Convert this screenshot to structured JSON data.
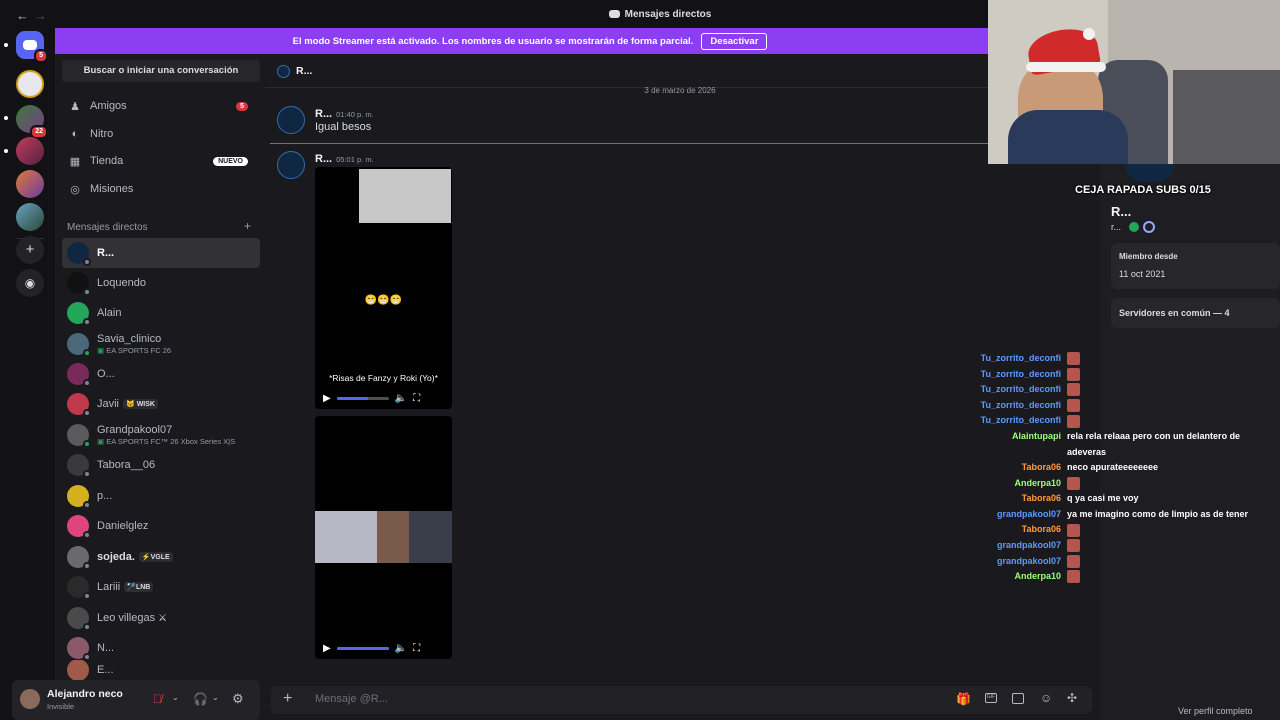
{
  "titlebar": {
    "title": "Mensajes directos",
    "back": "←",
    "forward": "→"
  },
  "banner": {
    "text": "El modo Streamer está activado. Los nombres de usuario se mostrarán de forma parcial.",
    "button": "Desactivar"
  },
  "rail": {
    "home_badge": "5",
    "server_badge": "22"
  },
  "sidebar": {
    "search": "Buscar o iniciar una conversación",
    "nav": [
      {
        "label": "Amigos",
        "badge": "5"
      },
      {
        "label": "Nitro"
      },
      {
        "label": "Tienda",
        "badge": "NUEVO"
      },
      {
        "label": "Misiones"
      }
    ],
    "dm_header": "Mensajes directos",
    "dms": [
      {
        "name": "R...",
        "sub": ""
      },
      {
        "name": "Loquendo",
        "sub": ""
      },
      {
        "name": "Alain",
        "sub": ""
      },
      {
        "name": "Savia_clinico",
        "sub": "EA SPORTS FC 26"
      },
      {
        "name": "O...",
        "sub": ""
      },
      {
        "name": "Javii",
        "tag": "WISK"
      },
      {
        "name": "Grandpakool07",
        "sub": "EA SPORTS FC™ 26 Xbox Series X|S"
      },
      {
        "name": "Tabora__06",
        "sub": ""
      },
      {
        "name": "p...",
        "sub": ""
      },
      {
        "name": "Danielglez",
        "sub": ""
      },
      {
        "name": "sojeda.",
        "tag": "VGLE"
      },
      {
        "name": "Lariii",
        "tag": "LNB"
      },
      {
        "name": "Leo villegas",
        "sub": ""
      },
      {
        "name": "N...",
        "sub": ""
      },
      {
        "name": "E...",
        "sub": ""
      }
    ]
  },
  "user": {
    "name": "Alejandro neco",
    "status": "Invisible"
  },
  "chat": {
    "header": "R...",
    "date": "3 de marzo de 2026",
    "messages": [
      {
        "author": "R...",
        "time": "01:40 p. m.",
        "text": "Igual besos"
      },
      {
        "author": "R...",
        "time": "05:01 p. m."
      }
    ],
    "video1_caption": "*Risas de Fanzy y Roki (Yo)*",
    "video1_emoji": "😁😁😁",
    "video1_progress": 0.6,
    "video2_progress": 1.0,
    "composer_placeholder": "Mensaje @R..."
  },
  "profile": {
    "name": "R...",
    "username": "r...",
    "member_since_label": "Miembro desde",
    "member_since": "11 oct 2021",
    "servers": "Servidores en común — 4",
    "full_profile": "Ver perfil completo"
  },
  "overlay": {
    "cam_text": "CEJA RAPADA SUBS 0/15"
  },
  "twitch_chat": [
    {
      "user": "Tu_zorrito_deconfi",
      "color": "#5b9bff",
      "msg": "",
      "emote": true
    },
    {
      "user": "Tu_zorrito_deconfi",
      "color": "#5b9bff",
      "msg": "",
      "emote": true
    },
    {
      "user": "Tu_zorrito_deconfi",
      "color": "#5b9bff",
      "msg": "",
      "emote": true
    },
    {
      "user": "Tu_zorrito_deconfi",
      "color": "#5b9bff",
      "msg": "",
      "emote": true
    },
    {
      "user": "Tu_zorrito_deconfi",
      "color": "#5b9bff",
      "msg": "",
      "emote": true
    },
    {
      "user": "Alaintupapi",
      "color": "#9cff7a",
      "msg": "rela rela relaaa pero con un delantero de adeveras",
      "emote": false
    },
    {
      "user": "Tabora06",
      "color": "#ff9a3c",
      "msg": "neco apurateeeeeeee",
      "emote": false
    },
    {
      "user": "Anderpa10",
      "color": "#9cff7a",
      "msg": "",
      "emote": true
    },
    {
      "user": "Tabora06",
      "color": "#ff9a3c",
      "msg": "q ya casi me voy",
      "emote": false
    },
    {
      "user": "grandpakool07",
      "color": "#5b9bff",
      "msg": "ya me imagino como de limpio as de tener",
      "emote": false
    },
    {
      "user": "Tabora06",
      "color": "#ff9a3c",
      "msg": "",
      "emote": true
    },
    {
      "user": "grandpakool07",
      "color": "#5b9bff",
      "msg": "",
      "emote": true
    },
    {
      "user": "grandpakool07",
      "color": "#5b9bff",
      "msg": "",
      "emote": true
    },
    {
      "user": "Anderpa10",
      "color": "#9cff7a",
      "msg": "",
      "emote": true
    }
  ],
  "colors": {
    "accent": "#5865f2",
    "banner": "#8b3ef2",
    "danger": "#da373c"
  }
}
